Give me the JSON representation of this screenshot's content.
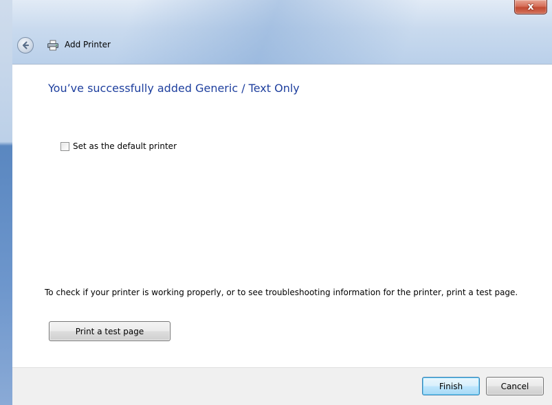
{
  "window": {
    "title": "Add Printer",
    "close_glyph": "x"
  },
  "icons": {
    "back": "back-arrow-icon",
    "printer": "printer-icon",
    "close": "close-icon"
  },
  "main": {
    "headline": "You’ve successfully added Generic / Text Only",
    "default_checkbox": {
      "label": "Set as the default printer",
      "checked": false
    },
    "info_text": "To check if your printer is working properly, or to see troubleshooting information for the printer, print a test page.",
    "test_button_label": "Print a test page"
  },
  "footer": {
    "finish_label": "Finish",
    "cancel_label": "Cancel"
  },
  "colors": {
    "headline": "#1e3f9e",
    "close_button": "#c24a32",
    "default_button_border": "#3c7fb1"
  }
}
